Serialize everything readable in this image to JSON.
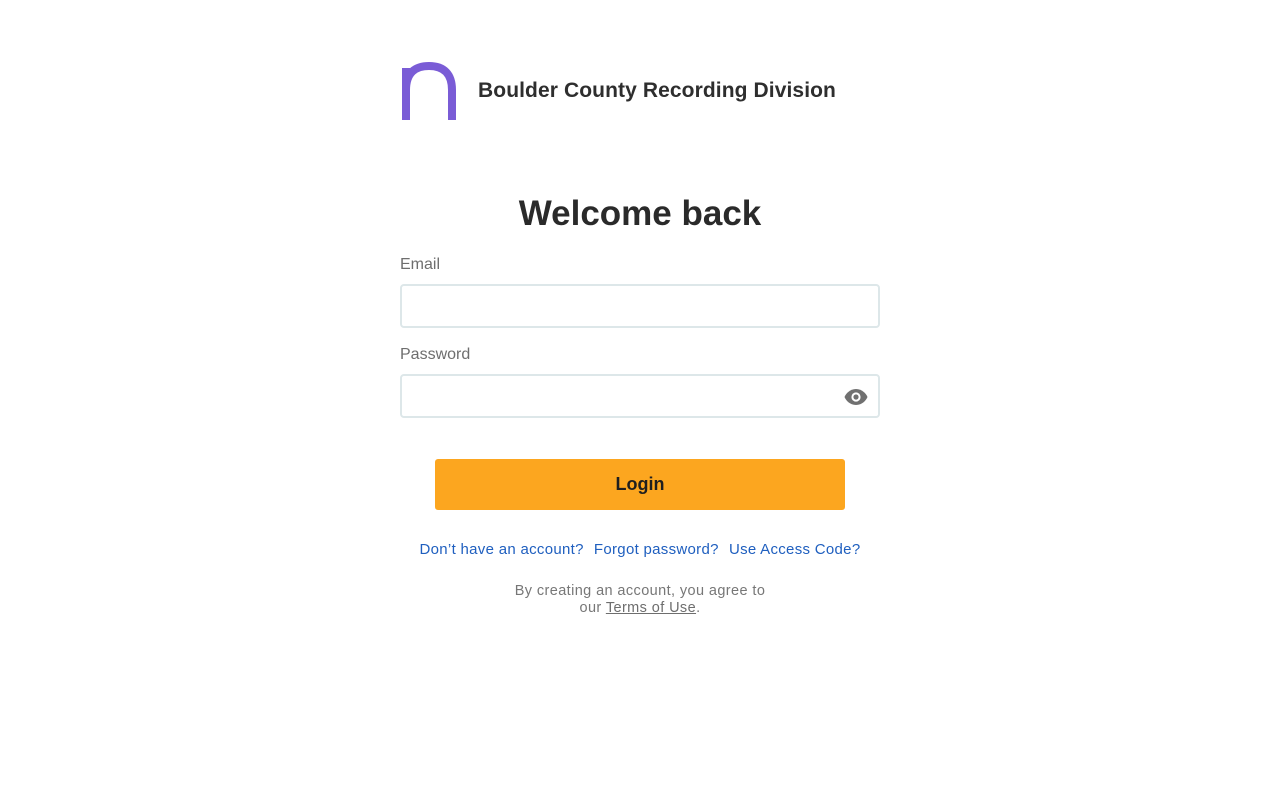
{
  "brand": {
    "logo_icon": "letter-n-logo-icon",
    "logo_color": "#7a5cd6",
    "name": "Boulder County Recording Division"
  },
  "form": {
    "title": "Welcome back",
    "email_label": "Email",
    "email_value": "",
    "password_label": "Password",
    "password_value": "",
    "password_toggle_icon": "eye-icon",
    "login_label": "Login",
    "login_color": "#fca61f"
  },
  "links": {
    "signup": "Don’t have an account?",
    "forgot": "Forgot password?",
    "access_code": "Use Access Code?",
    "link_color": "#1f5fbf"
  },
  "agreement": {
    "line1": "By creating an account, you agree to",
    "prefix": "our",
    "terms_link": "Terms of Use",
    "suffix": "."
  }
}
